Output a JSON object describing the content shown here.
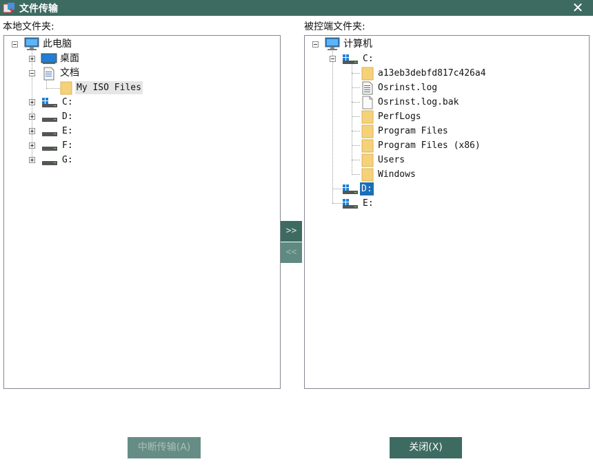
{
  "window": {
    "title": "文件传输",
    "close_glyph": "✕"
  },
  "local": {
    "label": "本地文件夹:",
    "tree": {
      "root": "此电脑",
      "desktop": "桌面",
      "documents": "文档",
      "doc_child": "My ISO Files",
      "drives": [
        "C:",
        "D:",
        "E:",
        "F:",
        "G:"
      ]
    }
  },
  "remote": {
    "label": "被控端文件夹:",
    "tree": {
      "root": "计算机",
      "drive_c": "C:",
      "c_children": [
        {
          "name": "a13eb3debfd817c426a4",
          "icon": "folder-icon"
        },
        {
          "name": "Osrinst.log",
          "icon": "text-file-icon"
        },
        {
          "name": "Osrinst.log.bak",
          "icon": "file-icon"
        },
        {
          "name": "PerfLogs",
          "icon": "folder-icon"
        },
        {
          "name": "Program Files",
          "icon": "folder-icon"
        },
        {
          "name": "Program Files (x86)",
          "icon": "folder-icon"
        },
        {
          "name": "Users",
          "icon": "folder-icon"
        },
        {
          "name": "Windows",
          "icon": "folder-icon"
        }
      ],
      "drive_d": "D:",
      "drive_e": "E:"
    }
  },
  "transfer": {
    "to_remote": ">>",
    "to_local": "<<"
  },
  "buttons": {
    "stop": "中断传输(A)",
    "close": "关闭(X)"
  },
  "colors": {
    "titlebar": "#3d6b62",
    "selection": "#1c6fb6",
    "folder": "#f5d27a"
  }
}
